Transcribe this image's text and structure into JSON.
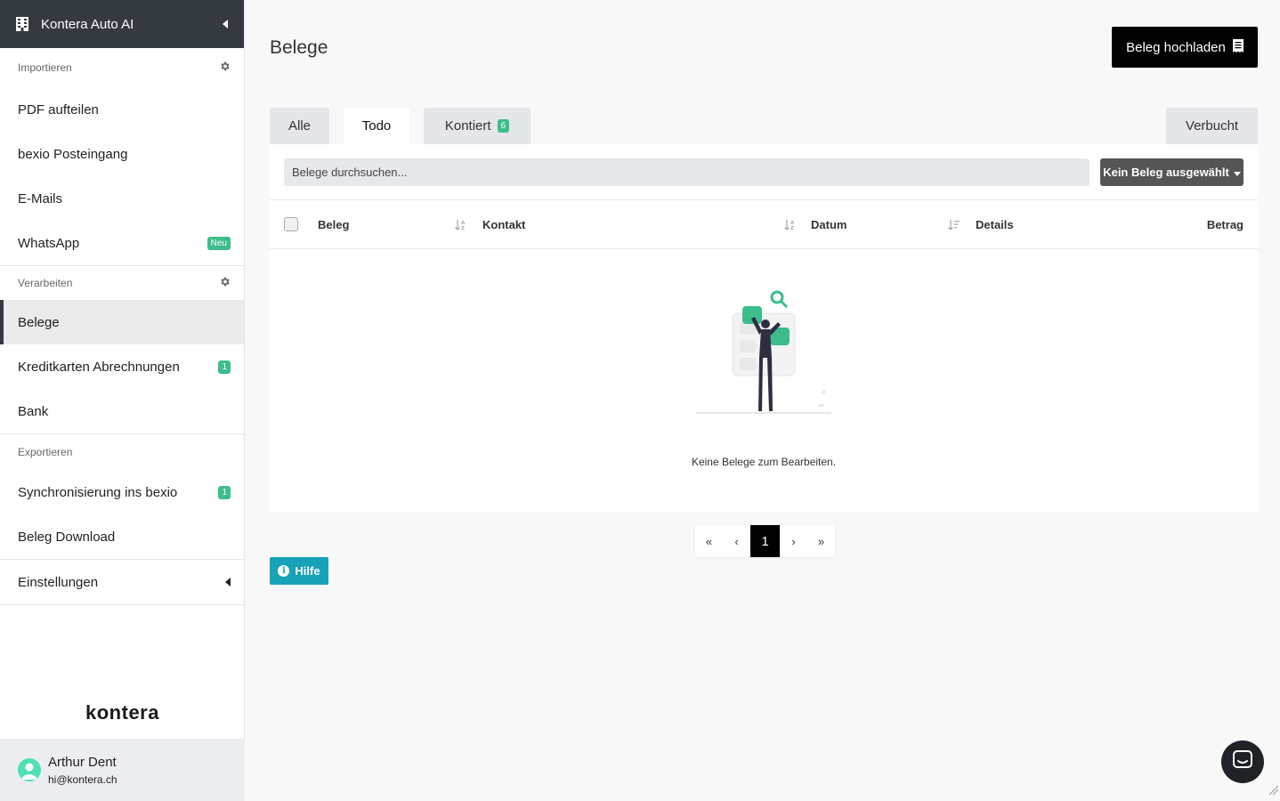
{
  "app": {
    "brand_name": "Kontera Auto AI",
    "logo_text": "kontera"
  },
  "sidebar": {
    "sections": [
      {
        "title": "Importieren",
        "items": [
          {
            "label": "PDF aufteilen"
          },
          {
            "label": "bexio Posteingang"
          },
          {
            "label": "E-Mails"
          },
          {
            "label": "WhatsApp",
            "badge": "Neu"
          }
        ]
      },
      {
        "title": "Verarbeiten",
        "items": [
          {
            "label": "Belege",
            "active": true
          },
          {
            "label": "Kreditkarten Abrechnungen",
            "badge": "1"
          },
          {
            "label": "Bank"
          }
        ]
      },
      {
        "title": "Exportieren",
        "items": [
          {
            "label": "Synchronisierung ins bexio",
            "badge": "1"
          },
          {
            "label": "Beleg Download"
          }
        ]
      }
    ],
    "settings_label": "Einstellungen"
  },
  "user": {
    "name": "Arthur Dent",
    "email": "hi@kontera.ch"
  },
  "page": {
    "title": "Belege",
    "upload_label": "Beleg hochladen"
  },
  "tabs": [
    {
      "label": "Alle"
    },
    {
      "label": "Todo",
      "active": true
    },
    {
      "label": "Kontiert",
      "count": "6"
    },
    {
      "label": "Verbucht"
    }
  ],
  "search": {
    "placeholder": "Belege durchsuchen..."
  },
  "bulk_action": {
    "label": "Kein Beleg ausgewählt"
  },
  "table": {
    "columns": [
      "Beleg",
      "Kontakt",
      "Datum",
      "Details",
      "Betrag"
    ]
  },
  "empty_state": {
    "text": "Keine Belege zum Bearbeiten."
  },
  "pagination": {
    "first": "«",
    "prev": "‹",
    "current": "1",
    "next": "›",
    "last": "»"
  },
  "help": {
    "label": "Hilfe"
  },
  "colors": {
    "sidebar_header": "#343a40",
    "accent_green": "#3dbd8c",
    "help_teal": "#17a2b8",
    "primary_black": "#000000"
  }
}
